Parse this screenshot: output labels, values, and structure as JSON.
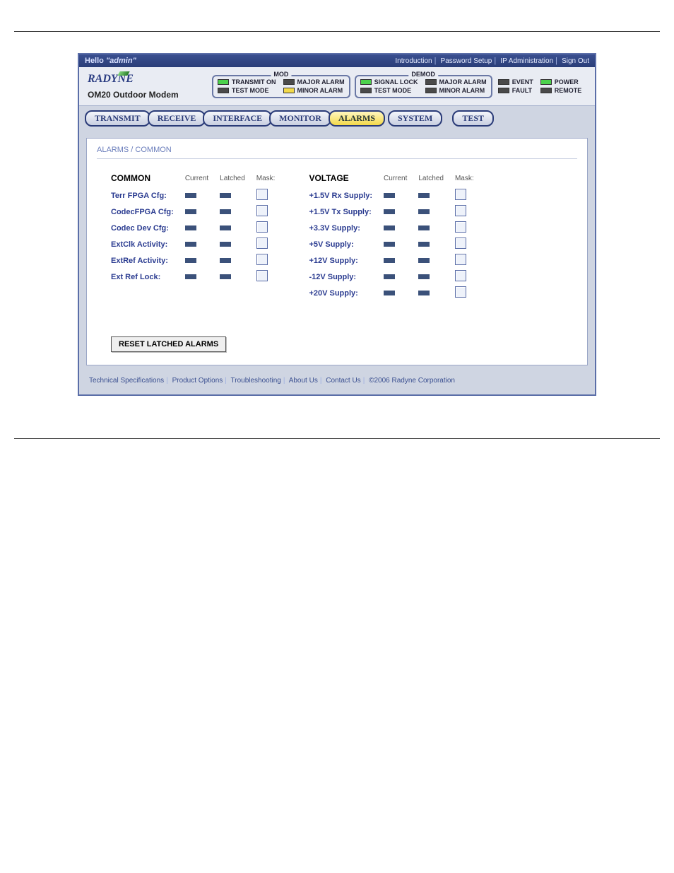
{
  "topbar": {
    "greeting_prefix": "Hello",
    "user": "\"admin\"",
    "links": [
      "Introduction",
      "Password Setup",
      "IP Administration",
      "Sign Out"
    ]
  },
  "brand": {
    "logo_text": "RADYNE",
    "product": "OM20 Outdoor Modem"
  },
  "status": {
    "mod": {
      "title": "MOD",
      "items": [
        {
          "led": "green",
          "label": "TRANSMIT ON"
        },
        {
          "led": "dark",
          "label": "MAJOR ALARM"
        },
        {
          "led": "dark",
          "label": "TEST MODE"
        },
        {
          "led": "yellow",
          "label": "MINOR ALARM"
        }
      ]
    },
    "demod": {
      "title": "DEMOD",
      "items": [
        {
          "led": "green",
          "label": "SIGNAL LOCK"
        },
        {
          "led": "dark",
          "label": "MAJOR ALARM"
        },
        {
          "led": "dark",
          "label": "TEST MODE"
        },
        {
          "led": "dark",
          "label": "MINOR ALARM"
        }
      ]
    },
    "side": [
      {
        "led": "dark",
        "label": "EVENT"
      },
      {
        "led": "green",
        "label": "POWER"
      },
      {
        "led": "dark",
        "label": "FAULT"
      },
      {
        "led": "dark",
        "label": "REMOTE"
      }
    ]
  },
  "tabs": [
    "TRANSMIT",
    "RECEIVE",
    "INTERFACE",
    "MONITOR",
    "ALARMS",
    "SYSTEM",
    "TEST"
  ],
  "active_tab": "ALARMS",
  "section": {
    "title": "ALARMS / COMMON"
  },
  "columns": {
    "headers": [
      "Current",
      "Latched",
      "Mask:"
    ]
  },
  "common": {
    "group_label": "COMMON",
    "rows": [
      "Terr FPGA Cfg:",
      "CodecFPGA Cfg:",
      "Codec Dev Cfg:",
      "ExtClk Activity:",
      "ExtRef Activity:",
      "Ext Ref Lock:"
    ]
  },
  "voltage": {
    "group_label": "VOLTAGE",
    "rows": [
      "+1.5V Rx Supply:",
      "+1.5V Tx Supply:",
      "+3.3V Supply:",
      "+5V Supply:",
      "+12V Supply:",
      "-12V Supply:",
      "+20V Supply:"
    ]
  },
  "reset_button": "RESET LATCHED ALARMS",
  "footer": {
    "links": [
      "Technical Specifications",
      "Product Options",
      "Troubleshooting",
      "About Us",
      "Contact Us"
    ],
    "copyright": "©2006 Radyne Corporation"
  }
}
